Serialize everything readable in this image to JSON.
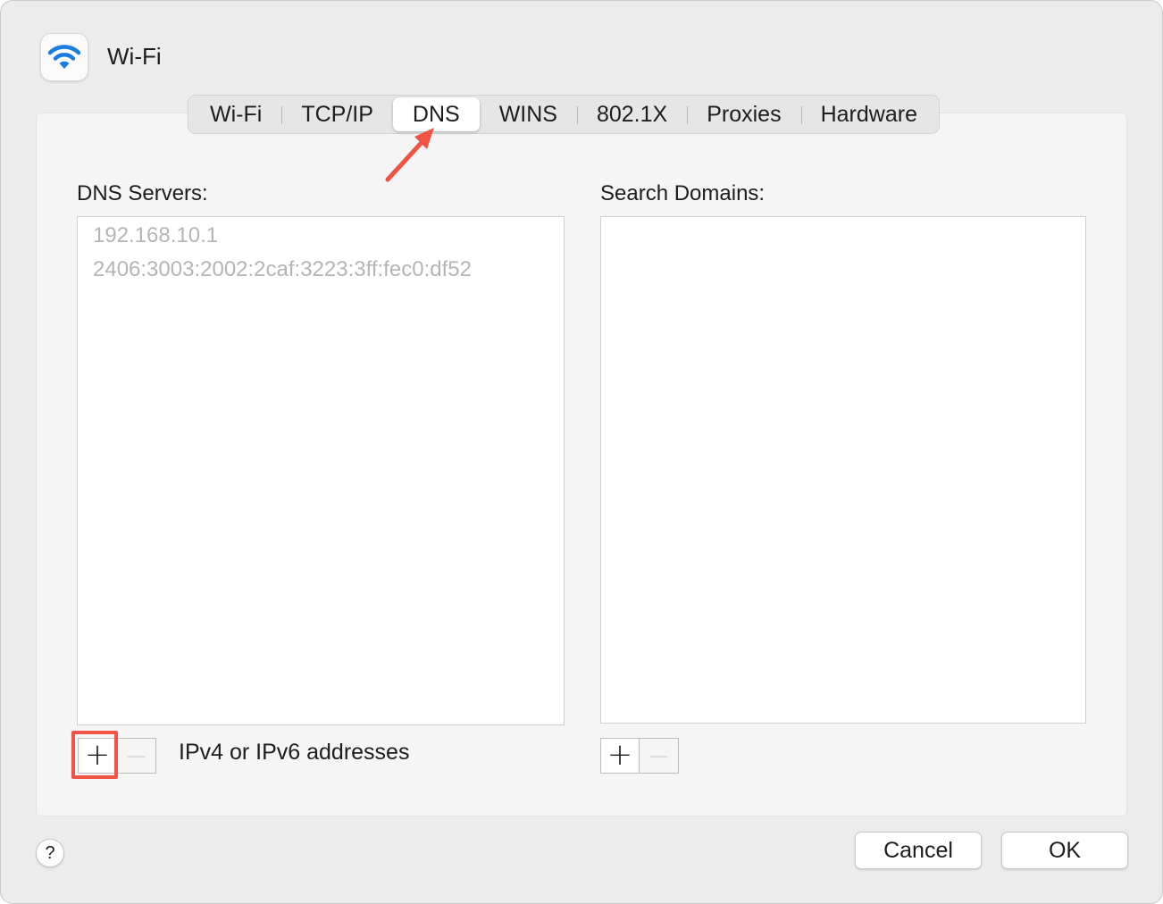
{
  "header": {
    "title": "Wi-Fi",
    "icon": "wifi-icon",
    "icon_color": "#1a7ce0"
  },
  "tabs": [
    {
      "label": "Wi-Fi",
      "active": false
    },
    {
      "label": "TCP/IP",
      "active": false
    },
    {
      "label": "DNS",
      "active": true
    },
    {
      "label": "WINS",
      "active": false
    },
    {
      "label": "802.1X",
      "active": false
    },
    {
      "label": "Proxies",
      "active": false
    },
    {
      "label": "Hardware",
      "active": false
    }
  ],
  "dns": {
    "label": "DNS Servers:",
    "servers": [
      "192.168.10.1",
      "2406:3003:2002:2caf:3223:3ff:fec0:df52"
    ],
    "add_label": "+",
    "remove_label": "—",
    "hint": "IPv4 or IPv6 addresses"
  },
  "search": {
    "label": "Search Domains:",
    "domains": [],
    "add_label": "+",
    "remove_label": "—"
  },
  "footer": {
    "help_label": "?",
    "cancel_label": "Cancel",
    "ok_label": "OK"
  },
  "annotations": {
    "highlight_color": "#ef5445"
  }
}
